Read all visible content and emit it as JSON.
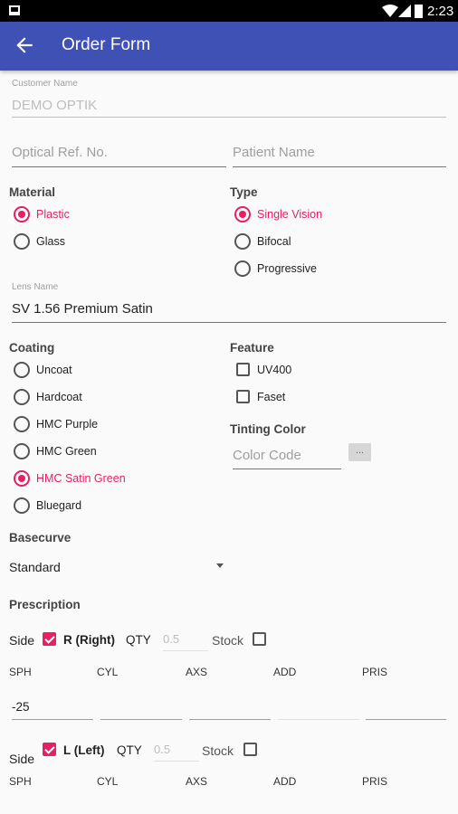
{
  "status": {
    "time": "2:23"
  },
  "appbar": {
    "title": "Order Form",
    "back_icon": "arrow-left-icon"
  },
  "customer": {
    "label": "Customer Name",
    "value": "DEMO OPTIK"
  },
  "optical_ref": {
    "placeholder": "Optical Ref. No."
  },
  "patient": {
    "placeholder": "Patient Name"
  },
  "material": {
    "label": "Material",
    "options": [
      "Plastic",
      "Glass"
    ],
    "selected": "Plastic"
  },
  "type": {
    "label": "Type",
    "options": [
      "Single Vision",
      "Bifocal",
      "Progressive"
    ],
    "selected": "Single Vision"
  },
  "lens": {
    "label": "Lens Name",
    "value": "SV 1.56 Premium Satin"
  },
  "coating": {
    "label": "Coating",
    "options": [
      "Uncoat",
      "Hardcoat",
      "HMC Purple",
      "HMC Green",
      "HMC Satin Green",
      "Bluegard"
    ],
    "selected": "HMC Satin Green"
  },
  "feature": {
    "label": "Feature",
    "options": [
      "UV400",
      "Faset"
    ]
  },
  "tinting": {
    "label": "Tinting Color",
    "placeholder": "Color Code",
    "button": "..."
  },
  "basecurve": {
    "label": "Basecurve",
    "value": "Standard"
  },
  "prescription": {
    "label": "Prescription",
    "right": {
      "side": "Side",
      "eye": "R (Right)",
      "qty_label": "QTY",
      "qty_placeholder": "0.5",
      "stock": "Stock",
      "sph_value": "-25"
    },
    "left": {
      "side": "Side",
      "eye": "L (Left)",
      "qty_label": "QTY",
      "qty_placeholder": "0.5",
      "stock": "Stock"
    },
    "columns": [
      "SPH",
      "CYL",
      "AXS",
      "ADD",
      "PRIS"
    ]
  },
  "colors": {
    "primary": "#3f51b5",
    "accent": "#e91e63"
  }
}
